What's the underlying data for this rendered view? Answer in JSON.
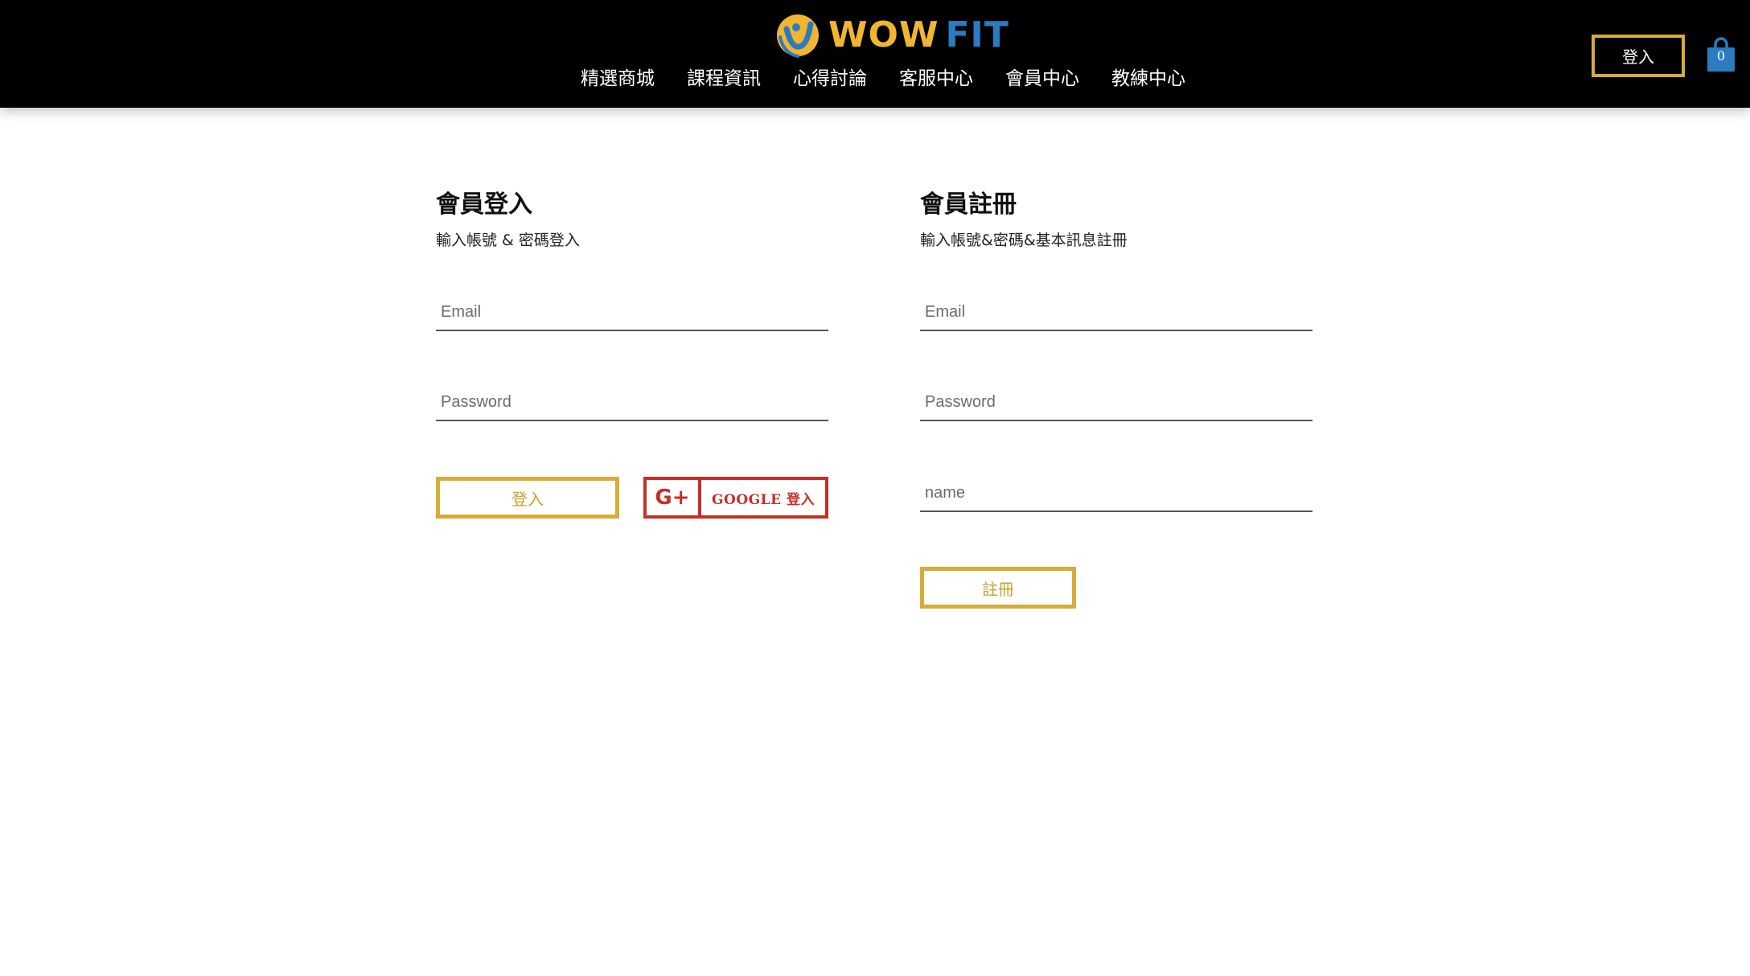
{
  "header": {
    "logo": {
      "word1": "WOW",
      "word2": "FIT"
    },
    "nav": [
      {
        "label": "精選商城"
      },
      {
        "label": "課程資訊"
      },
      {
        "label": "心得討論"
      },
      {
        "label": "客服中心"
      },
      {
        "label": "會員中心"
      },
      {
        "label": "教練中心"
      }
    ],
    "login_label": "登入",
    "cart_count": "0",
    "colors": {
      "bar": "#000000",
      "gold": "#d6ac3a",
      "blue": "#2a7bc0",
      "logo_yellow": "#f1b52f"
    }
  },
  "login": {
    "title": "會員登入",
    "subtitle": "輸入帳號 & 密碼登入",
    "email_placeholder": "Email",
    "password_placeholder": "Password",
    "submit_label": "登入",
    "google_icon": "G+",
    "google_label": "GOOGLE 登入"
  },
  "register": {
    "title": "會員註冊",
    "subtitle": "輸入帳號&密碼&基本訊息註冊",
    "email_placeholder": "Email",
    "password_placeholder": "Password",
    "name_placeholder": "name",
    "submit_label": "註冊"
  },
  "icons": {
    "logo": "wowfit-logo-icon",
    "cart": "shopping-bag-icon",
    "google": "google-plus-icon"
  },
  "accent_colors": {
    "gold": "#d6ac3a",
    "google_red": "#c62f26"
  }
}
